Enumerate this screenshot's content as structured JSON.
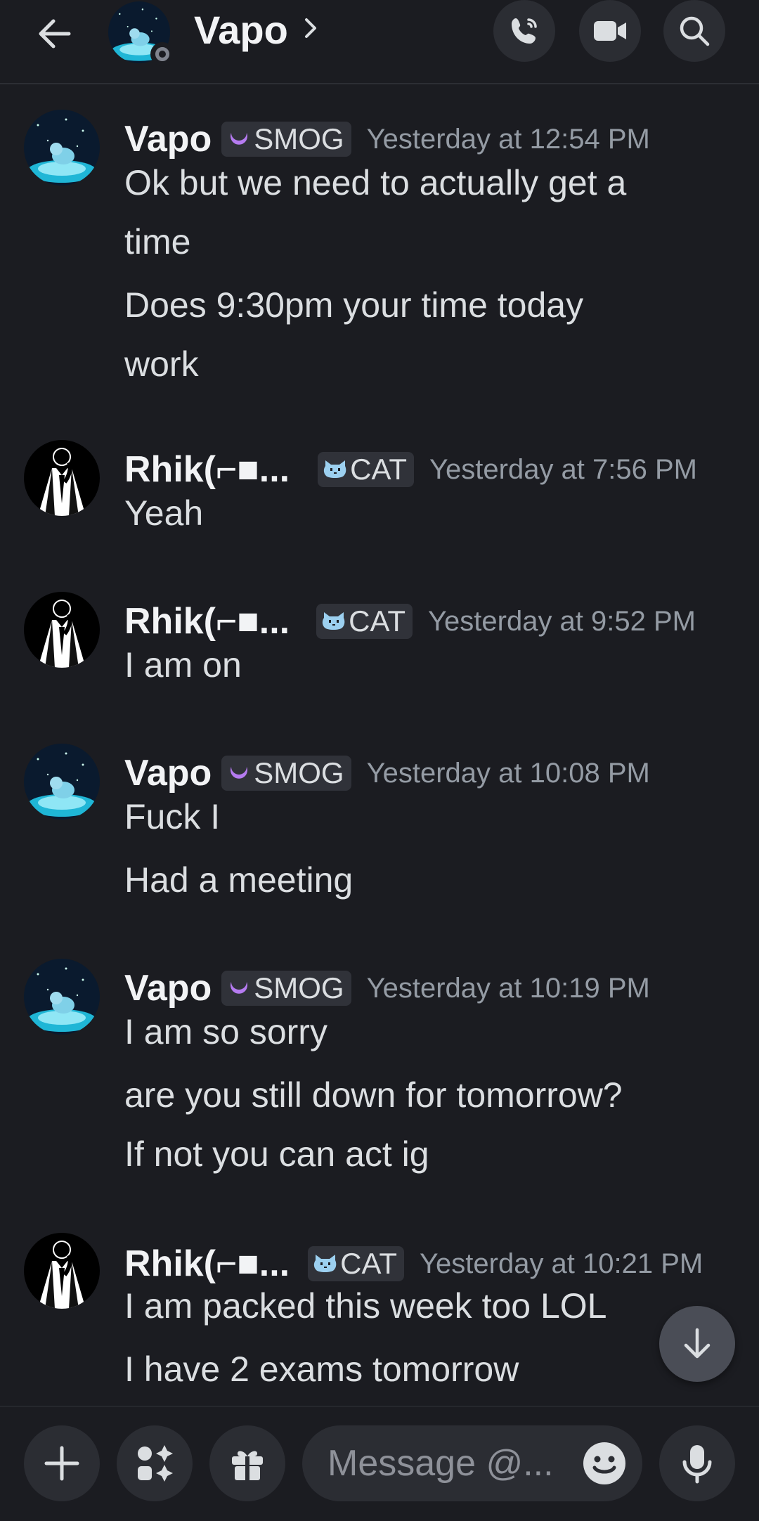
{
  "header": {
    "title": "Vapo"
  },
  "messages": [
    {
      "author": "Vapo",
      "tag": "SMOG",
      "tag_icon": "purple-moon-icon",
      "time": "Yesterday at 12:54 PM",
      "lines": [
        "Ok but we need to actually get a",
        "time",
        "Does 9:30pm your time today",
        "work"
      ]
    },
    {
      "author": "Rhik(⌐■...",
      "tag": "CAT",
      "tag_icon": "cat-icon",
      "time": "Yesterday at 7:56 PM",
      "lines": [
        "Yeah"
      ]
    },
    {
      "author": "Rhik(⌐■...",
      "tag": "CAT",
      "tag_icon": "cat-icon",
      "time": "Yesterday at 9:52 PM",
      "lines": [
        "I am on"
      ]
    },
    {
      "author": "Vapo",
      "tag": "SMOG",
      "tag_icon": "purple-moon-icon",
      "time": "Yesterday at 10:08 PM",
      "lines": [
        "Fuck I",
        "Had a meeting"
      ]
    },
    {
      "author": "Vapo",
      "tag": "SMOG",
      "tag_icon": "purple-moon-icon",
      "time": "Yesterday at 10:19 PM",
      "lines": [
        "I am so sorry",
        "are you still down for tomorrow?",
        "If not you can act ig"
      ]
    },
    {
      "author": "Rhik(⌐■...",
      "tag": "CAT",
      "tag_icon": "cat-icon",
      "time": "Yesterday at 10:21 PM",
      "lines": [
        "I am packed this week too LOL",
        "I have 2 exams tomorrow"
      ]
    }
  ],
  "composer": {
    "placeholder": "Message @..."
  },
  "colors": {
    "background": "#1b1c21",
    "button_bg": "#2b2d33",
    "tag_bg": "#303239",
    "muted_text": "#949ba4",
    "moon_purple": "#b57bf0"
  }
}
